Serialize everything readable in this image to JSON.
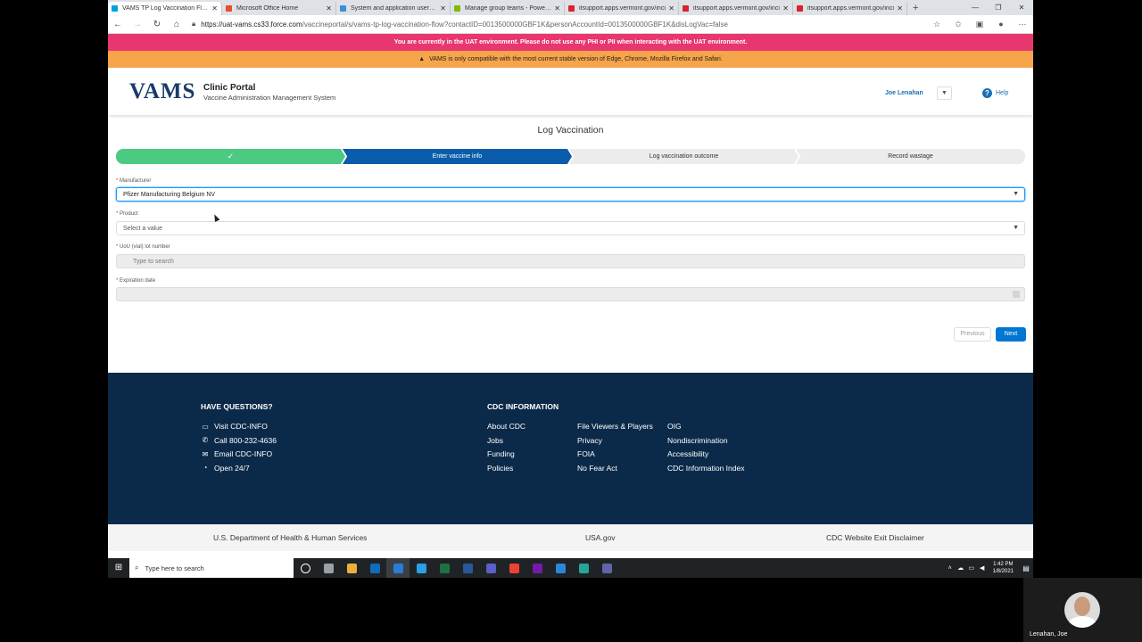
{
  "browser": {
    "tabs": [
      {
        "label": "VAMS TP Log Vaccination Flow",
        "favicon_color": "#00a1e0",
        "active": true
      },
      {
        "label": "Microsoft Office Home",
        "favicon_color": "#e74c2b",
        "active": false
      },
      {
        "label": "System and application users - X",
        "favicon_color": "#3a8fd8",
        "active": false
      },
      {
        "label": "Manage group teams - Power Pl",
        "favicon_color": "#7fba00",
        "active": false
      },
      {
        "label": "itsupport.apps.vermont.gov/inci",
        "favicon_color": "#d9232d",
        "active": false
      },
      {
        "label": "itsupport.apps.vermont.gov/inci",
        "favicon_color": "#d9232d",
        "active": false
      },
      {
        "label": "itsupport.apps.vermont.gov/inci",
        "favicon_color": "#d9232d",
        "active": false
      }
    ],
    "new_tab": "+",
    "url_host": "https://uat-vams.cs33.force.com",
    "url_path": "/vaccineportal/s/vams-tp-log-vaccination-flow?contactID=0013500000GBF1K&personAccountId=0013500000GBF1K&disLogVac=false"
  },
  "banners": {
    "uat": "You are currently in the UAT environment. Please do not use any PHI or PII when interacting with the UAT environment.",
    "compat": "VAMS is only compatible with the most current stable version of Edge, Chrome, Mozilla Firefox and Safari."
  },
  "header": {
    "logo_text": "VAMS",
    "portal_title": "Clinic Portal",
    "portal_subtitle": "Vaccine Administration Management System",
    "user_name": "Joe Lenahan",
    "help_label": "Help"
  },
  "page": {
    "title": "Log Vaccination",
    "steps": [
      {
        "label": "✓",
        "state": "complete"
      },
      {
        "label": "Enter vaccine info",
        "state": "current"
      },
      {
        "label": "Log vaccination outcome",
        "state": "upcoming"
      },
      {
        "label": "Record wastage",
        "state": "upcoming"
      }
    ],
    "required_marker": "*",
    "fields": {
      "manufacturer": {
        "label": "Manufacturer",
        "value": "Pfizer Manufacturing Belgium NV"
      },
      "product": {
        "label": "Product",
        "placeholder": "Select a value"
      },
      "lot": {
        "label": "UoU (vial) lot number",
        "placeholder": "Type to search"
      },
      "expiration": {
        "label": "Expiration date",
        "value": ""
      }
    },
    "previous_label": "Previous",
    "next_label": "Next"
  },
  "footer": {
    "questions_heading": "HAVE QUESTIONS?",
    "contacts": [
      {
        "icon": "monitor-icon",
        "label": "Visit CDC-INFO"
      },
      {
        "icon": "phone-icon",
        "label": "Call 800-232-4636"
      },
      {
        "icon": "envelope-icon",
        "label": "Email CDC-INFO"
      },
      {
        "icon": "clock-icon",
        "label": "Open 24/7"
      }
    ],
    "cdc_heading": "CDC INFORMATION",
    "col1": [
      "About CDC",
      "Jobs",
      "Funding",
      "Policies"
    ],
    "col2": [
      "File Viewers & Players",
      "Privacy",
      "FOIA",
      "No Fear Act"
    ],
    "col3": [
      "OIG",
      "Nondiscrimination",
      "Accessibility",
      "CDC Information Index"
    ],
    "sub": [
      "U.S. Department of Health & Human Services",
      "USA.gov",
      "CDC Website Exit Disclaimer"
    ]
  },
  "taskbar": {
    "search_placeholder": "Type here to search",
    "app_icons": [
      "#ffffff",
      "#9aa0a6",
      "#e8b23a",
      "#0f6cbd",
      "#2b7cd3",
      "#2ba0e8",
      "#1e7145",
      "#2b579a",
      "#5b5fc7",
      "#ea4335",
      "#7719aa",
      "#2b88d8",
      "#26a69a",
      "#6264a7"
    ],
    "time": "1:42 PM",
    "date": "1/8/2021"
  },
  "webcam": {
    "name": "Lenahan, Joe"
  },
  "colors": {
    "accent": "#0176d3",
    "step_complete": "#4bca81",
    "step_current": "#0b5cab",
    "footer_bg": "#0b2a4a",
    "uat_banner": "#e8366f",
    "compat_banner": "#f6a54a"
  }
}
